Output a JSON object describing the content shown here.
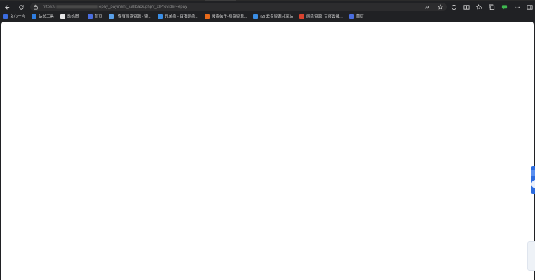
{
  "browser": {
    "url_prefix": "https://",
    "url_suffix": "epay_payment_callback.php?_xlProvider=epay"
  },
  "bookmarks": [
    {
      "label": "文心一言",
      "icon": "ernie-bot-icon",
      "color": "#3b6ce0"
    },
    {
      "label": "站长工具",
      "icon": "webmaster-tools-icon",
      "color": "#2f7de1"
    },
    {
      "label": "动态图_",
      "icon": "gif-icon",
      "color": "#e6e6e6"
    },
    {
      "label": "首页",
      "icon": "home-page-icon",
      "color": "#4a6ee0"
    },
    {
      "label": "· 专有网盘资源 · 资...",
      "icon": "cloud-drive-icon",
      "color": "#5aa0e8"
    },
    {
      "label": "兄弟盘 - 百度网盘...",
      "icon": "baidu-drive-icon",
      "color": "#3a8ee6"
    },
    {
      "label": "搜索帖子-网盘资源...",
      "icon": "search-posts-icon",
      "color": "#e86a1a"
    },
    {
      "label": "(2) 云盘资源共享站",
      "icon": "cloud-share-icon",
      "color": "#3a8ee6"
    },
    {
      "label": "网盘资源_百度云搜...",
      "icon": "search-engine-icon",
      "color": "#d9432f"
    },
    {
      "label": "首页",
      "icon": "home-page-icon",
      "color": "#4a6ee0"
    }
  ]
}
